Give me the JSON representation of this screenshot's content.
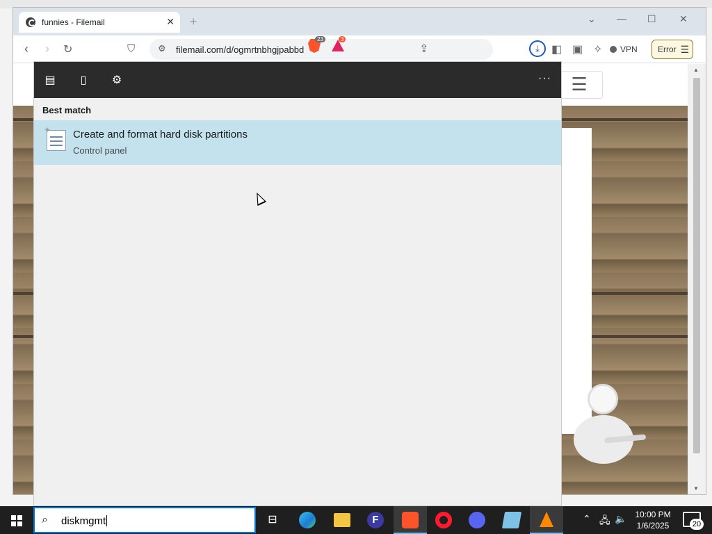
{
  "browser": {
    "tab_title": "funnies - Filemail",
    "url": "filemail.com/d/ogmrtnbhgjpabbd",
    "brave_shields_count": "23",
    "rewards_count": "3",
    "vpn_label": "VPN",
    "error_label": "Error"
  },
  "search_panel": {
    "section_heading": "Best match",
    "result": {
      "title": "Create and format hard disk partitions",
      "subtitle": "Control panel"
    }
  },
  "taskbar": {
    "search_query": "diskmgmt",
    "time": "10:00 PM",
    "date": "1/6/2025",
    "notification_count": "20",
    "apps": [
      "task-view",
      "edge",
      "file-explorer",
      "filezilla",
      "brave",
      "opera",
      "discord",
      "notepad",
      "vlc"
    ]
  },
  "colors": {
    "accent": "#0078d7",
    "result_highlight": "#c3e2ee",
    "search_toolbar": "#2b2b2b",
    "taskbar": "#1f1f1f"
  }
}
